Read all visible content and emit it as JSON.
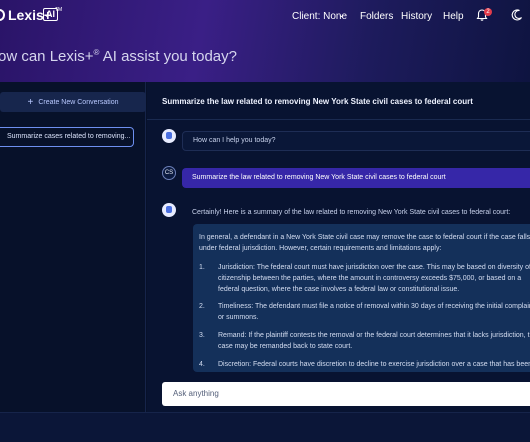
{
  "app": {
    "brand": "Lexis+",
    "badge": "AI",
    "tm": "TM"
  },
  "nav": {
    "client": "Client: None",
    "folders": "Folders",
    "history": "History",
    "help": "Help",
    "notifications_count": "2"
  },
  "greeting": {
    "prefix": "ow can Lexis+",
    "sup": "®",
    "suffix": " AI assist you today?"
  },
  "sidebar": {
    "new_conversation": "Create New Conversation",
    "conversations": [
      "Summarize cases related to removing..."
    ]
  },
  "chat": {
    "title": "Summarize the law related to removing New York State civil cases to federal court",
    "assistant_prompt": "How can I help you today?",
    "user_initials": "CS",
    "user_message": "Summarize the law related to removing New York State civil cases to federal court",
    "answer_intro": "Certainly! Here is a summary of the law related to removing New York State civil cases to federal court:",
    "answer_paragraph": "In general, a defendant in a New York State civil case may remove the case to federal court if the case falls under federal jurisdiction. However, certain requirements and limitations apply:",
    "answer_items": [
      {
        "num": "1.",
        "text": "Jurisdiction: The federal court must have jurisdiction over the case. This may be based on diversity of citizenship between the parties, where the amount in controversy exceeds $75,000, or based on a federal question, where the case involves a federal law or constitutional issue."
      },
      {
        "num": "2.",
        "text": "Timeliness: The defendant must file a notice of removal within 30 days of receiving the initial complaint or summons."
      },
      {
        "num": "3.",
        "text": "Remand: If the plaintiff contests the removal or the federal court determines that it lacks jurisdiction, the case may be remanded back to state court."
      },
      {
        "num": "4.",
        "text": "Discretion: Federal courts have discretion to decline to exercise jurisdiction over a case that has been"
      }
    ],
    "input_placeholder": "Ask anything"
  },
  "colors": {
    "hero_start": "#2a1468",
    "background": "#07112a",
    "user_bubble": "#3627a8",
    "answer_box": "#14305a",
    "badge_red": "#e23b4a"
  }
}
